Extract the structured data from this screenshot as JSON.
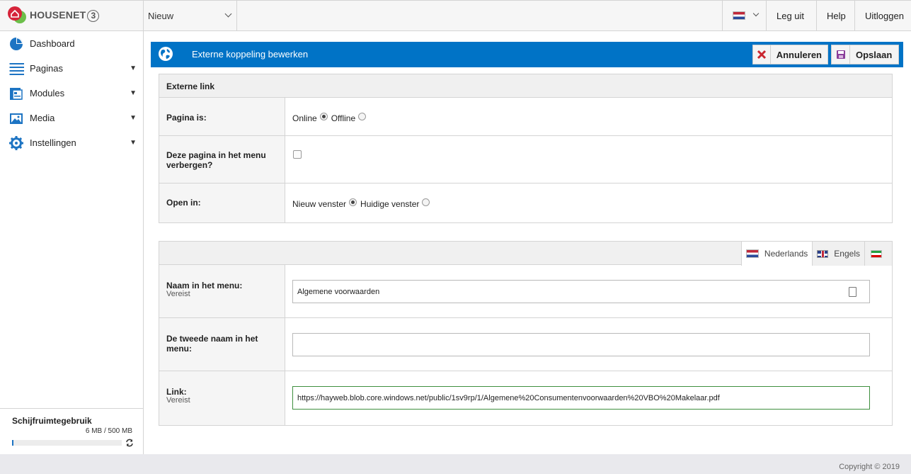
{
  "brand": {
    "name": "HOUSENET",
    "version": "3"
  },
  "site_selector": {
    "value": "Nieuw"
  },
  "topnav": {
    "leg_uit": "Leg uit",
    "help": "Help",
    "uitloggen": "Uitloggen"
  },
  "sidebar": {
    "items": [
      {
        "label": "Dashboard",
        "icon": "pie-chart-icon",
        "expandable": false
      },
      {
        "label": "Paginas",
        "icon": "list-icon",
        "expandable": true
      },
      {
        "label": "Modules",
        "icon": "modules-icon",
        "expandable": true
      },
      {
        "label": "Media",
        "icon": "image-icon",
        "expandable": true
      },
      {
        "label": "Instellingen",
        "icon": "gear-icon",
        "expandable": true
      }
    ],
    "caret": "▼",
    "disk": {
      "title": "Schijfruimtegebruik",
      "value": "6 MB / 500 MB",
      "used_fraction": 0.012
    }
  },
  "header": {
    "title": "Externe koppeling bewerken",
    "cancel_label": "Annuleren",
    "save_label": "Opslaan",
    "accent": "#0073c6"
  },
  "panel1": {
    "title": "Externe link",
    "pagina_is": {
      "label": "Pagina is:",
      "opt1": "Online",
      "opt2": "Offline",
      "selected": "Online"
    },
    "verbergen": {
      "label": "Deze pagina in het menu verbergen?",
      "checked": false
    },
    "open_in": {
      "label": "Open in:",
      "opt1": "Nieuw venster",
      "opt2": "Huidige venster",
      "selected": "Nieuw venster"
    }
  },
  "panel2": {
    "tabs": {
      "nl": "Nederlands",
      "en": "Engels"
    },
    "naam": {
      "label": "Naam in het menu:",
      "sub": "Vereist",
      "value": "Algemene voorwaarden"
    },
    "tweede": {
      "label": "De tweede naam in het menu:",
      "value": ""
    },
    "link": {
      "label": "Link:",
      "sub": "Vereist",
      "value": "https://hayweb.blob.core.windows.net/public/1sv9rp/1/Algemene%20Consumentenvoorwaarden%20VBO%20Makelaar.pdf"
    }
  },
  "footer": {
    "copyright": "Copyright © 2019"
  }
}
